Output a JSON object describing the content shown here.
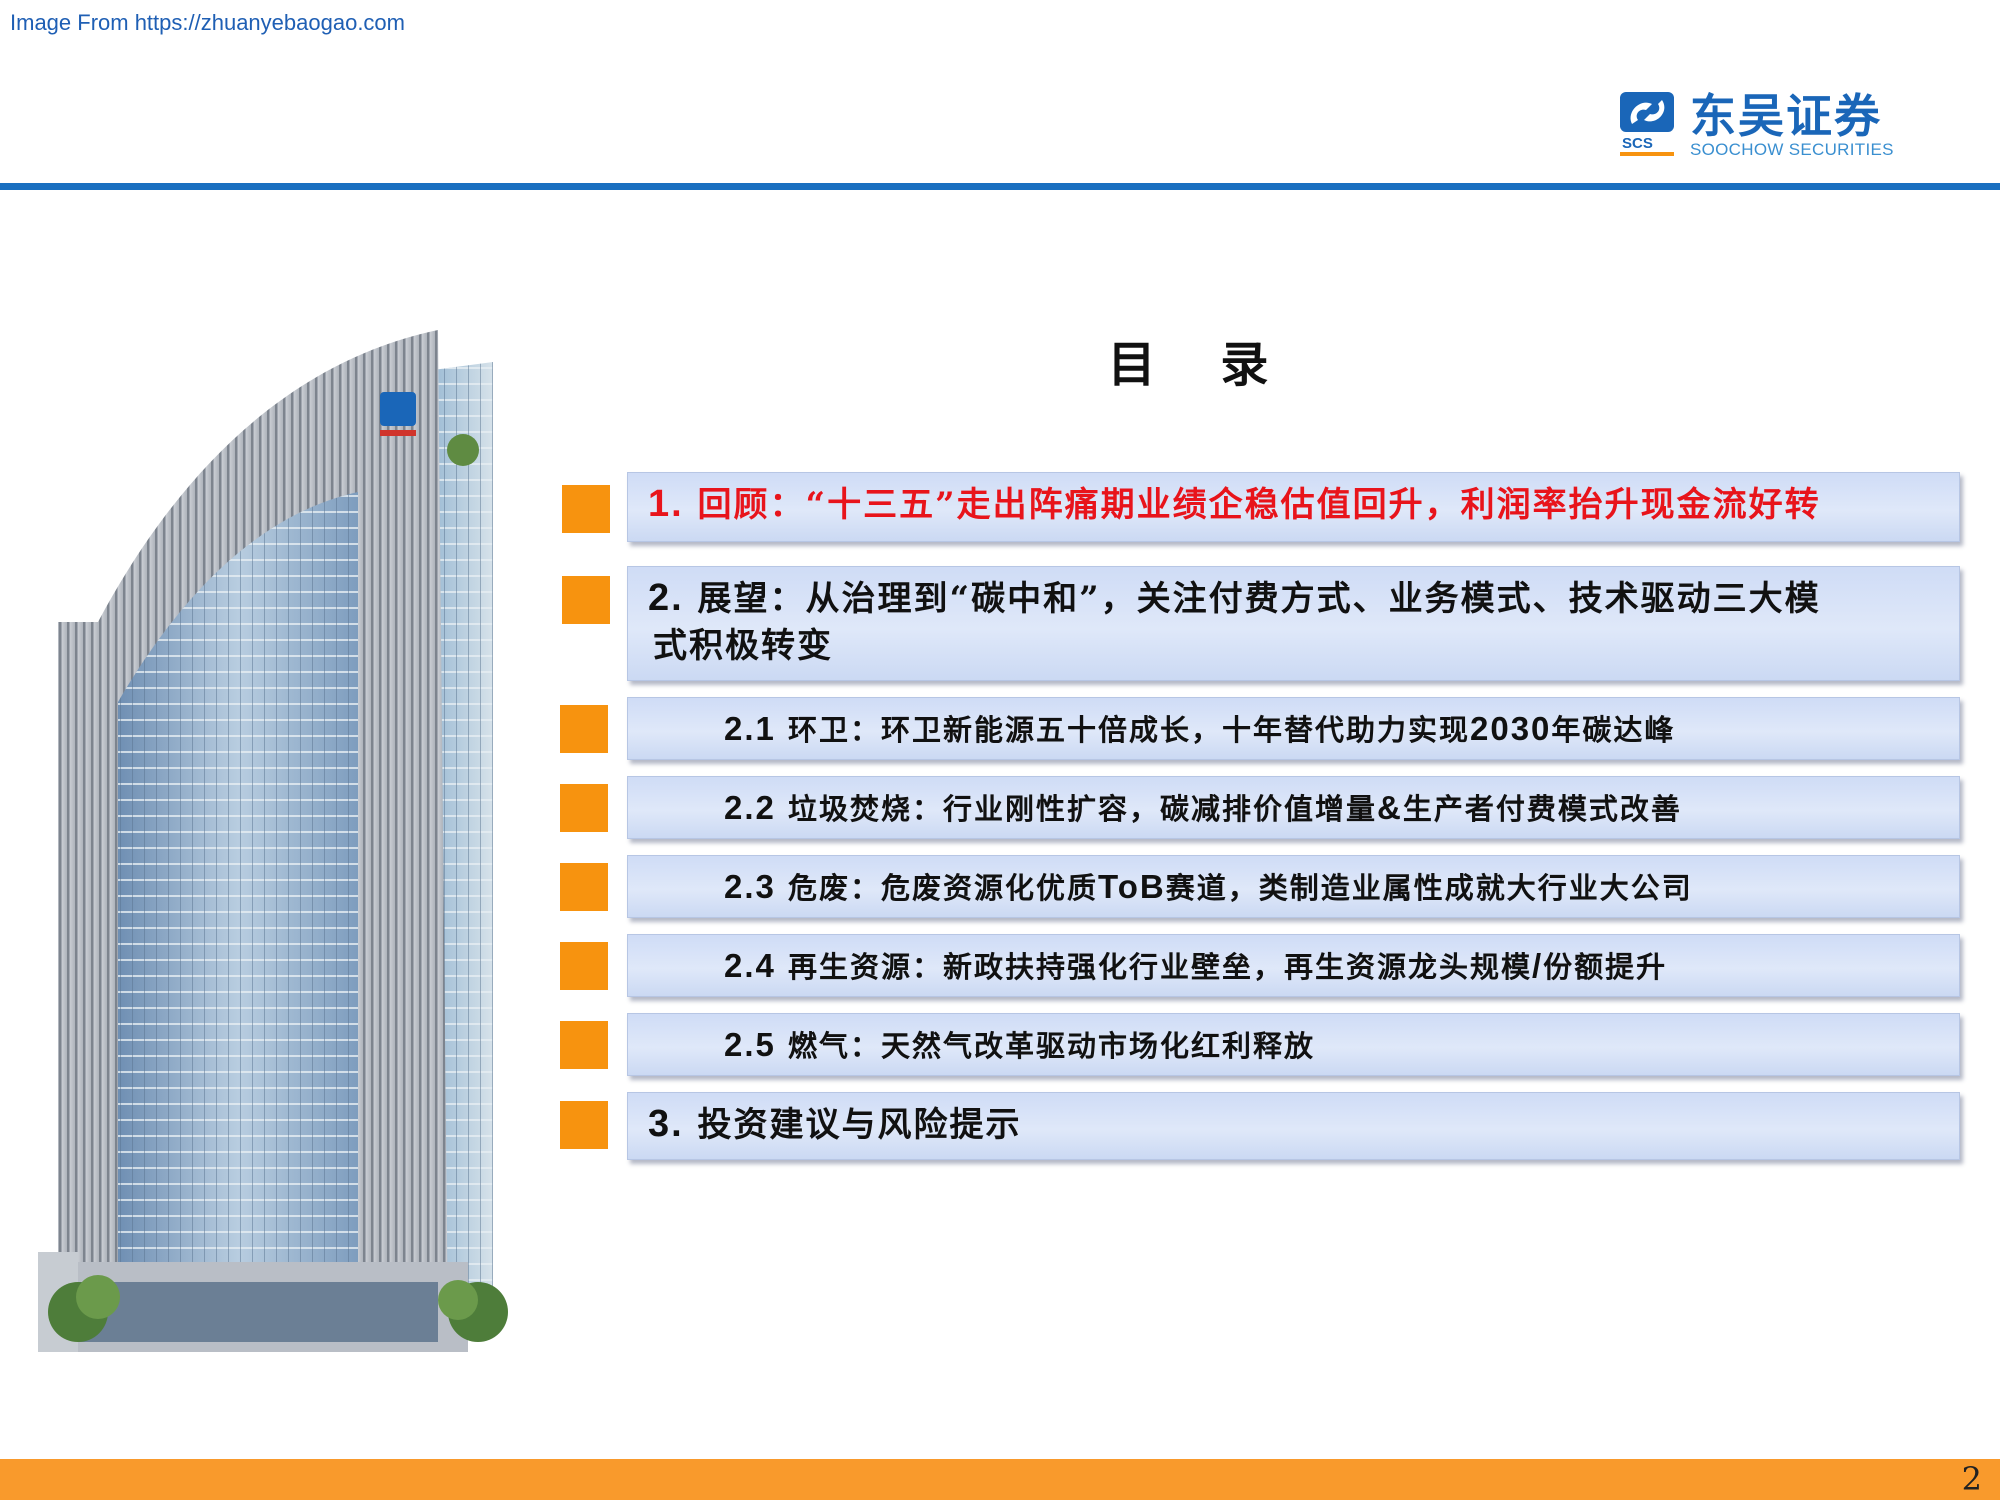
{
  "source_note": "Image From https://zhuanyebaogao.com",
  "logo": {
    "cn": "东吴证券",
    "en": "SOOCHOW SECURITIES",
    "mark_text": "SCS",
    "brand_color": "#1a66b8"
  },
  "toc": {
    "title": "目 录",
    "items": [
      {
        "num": "1.",
        "text": "回顾：“十三五”走出阵痛期业绩企稳估值回升，利润率抬升现金流好转",
        "highlight": true
      },
      {
        "num": "2.",
        "text_line1": "展望：从治理到“碳中和”，关注付费方式、业务模式、技术驱动三大模",
        "text_line2": "式积极转变"
      },
      {
        "num": "2.1",
        "text_a": "环卫：环卫新能源五十倍成长，十年替代助力实现",
        "text_b": "2030",
        "text_c": "年碳达峰"
      },
      {
        "num": "2.2",
        "text_a": "垃圾焚烧：行业刚性扩容，碳减排价值增量",
        "text_b": "&",
        "text_c": "生产者付费模式改善"
      },
      {
        "num": "2.3",
        "text_a": "危废：危废资源化优质",
        "text_b": "ToB",
        "text_c": "赛道，类制造业属性成就大行业大公司"
      },
      {
        "num": "2.4",
        "text_a": "再生资源：新政扶持强化行业壁垒，再生资源龙头规模",
        "text_b": "/",
        "text_c": "份额提升"
      },
      {
        "num": "2.5",
        "text": "燃气：天然气改革驱动市场化红利释放"
      },
      {
        "num": "3.",
        "text": "投资建议与风险提示"
      }
    ]
  },
  "colors": {
    "accent_orange": "#f7930f",
    "header_blue": "#1a6fc0",
    "highlight_red": "#e8141b",
    "box_fill": "#dfe8f9"
  },
  "page_number": "2"
}
